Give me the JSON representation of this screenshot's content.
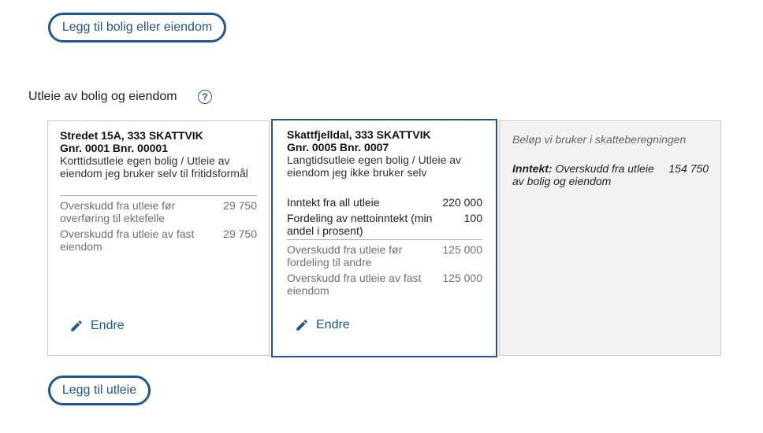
{
  "buttons": {
    "add_property": "Legg til bolig eller eiendom",
    "add_rental": "Legg til utleie"
  },
  "section": {
    "title": "Utleie av bolig og eiendom",
    "help": "?"
  },
  "cards": [
    {
      "address_line1": "Stredet 15A, 333 SKATTVIK",
      "address_line2": "Gnr. 0001 Bnr. 00001",
      "type": "Korttidsutleie egen bolig / Utleie av eiendom jeg bruker selv til fritidsformål",
      "rows": [
        {
          "label": "Overskudd fra utleie før overføring til ektefelle",
          "value": "29 750"
        },
        {
          "label": "Overskudd fra utleie av fast eiendom",
          "value": "29 750"
        }
      ],
      "edit_label": "Endre"
    },
    {
      "address_line1": "Skattfjelldal, 333 SKATTVIK",
      "address_line2": "Gnr. 0005 Bnr. 0007",
      "type": "Langtidsutleie egen bolig / Utleie av eiendom jeg ikke bruker selv",
      "input_rows": [
        {
          "label": "Inntekt fra all utleie",
          "value": "220 000"
        },
        {
          "label": "Fordeling av nettoinntekt (min andel i prosent)",
          "value": "100"
        }
      ],
      "rows": [
        {
          "label": "Overskudd fra utleie før fordeling til andre",
          "value": "125 000"
        },
        {
          "label": "Overskudd fra utleie av fast eiendom",
          "value": "125 000"
        }
      ],
      "edit_label": "Endre"
    }
  ],
  "summary": {
    "heading": "Beløp vi bruker i skatteberegningen",
    "result_key": "Inntekt:",
    "result_label": "Overskudd fra utleie av bolig og eiendom",
    "result_value": "154 750"
  },
  "icons": {
    "help": "question-circle-icon",
    "edit": "pencil-icon"
  },
  "colors": {
    "accent": "#1f5497",
    "summary_bg": "#f2f2f2"
  }
}
